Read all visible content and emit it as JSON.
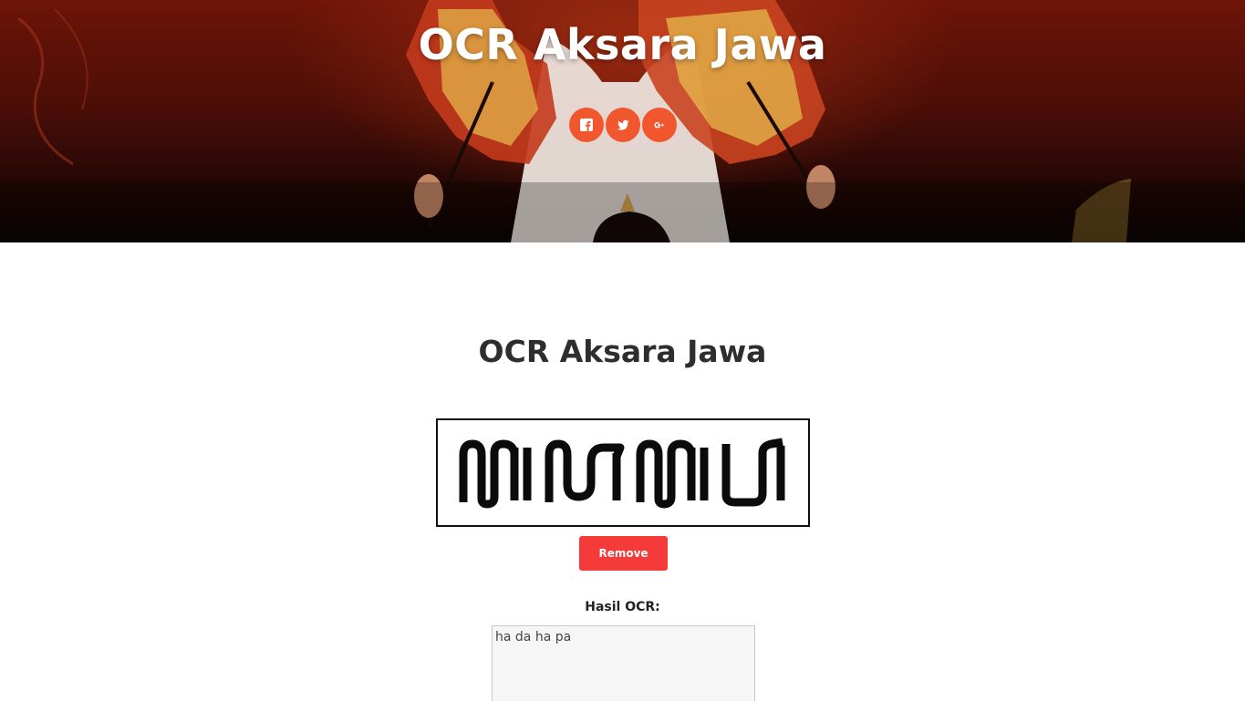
{
  "hero": {
    "title": "OCR Aksara Jawa",
    "social": [
      {
        "name": "facebook",
        "icon": "facebook-icon"
      },
      {
        "name": "twitter",
        "icon": "twitter-icon"
      },
      {
        "name": "google-plus",
        "icon": "google-plus-icon"
      }
    ]
  },
  "main": {
    "title": "OCR Aksara Jawa",
    "uploaded_image": "javanese-script-image",
    "remove_label": "Remove",
    "result_label": "Hasil OCR:",
    "result_value": "ha da ha pa"
  },
  "colors": {
    "accent": "#f0572f",
    "remove_button": "#f53a3a",
    "hero_dark": "#1e0705"
  }
}
